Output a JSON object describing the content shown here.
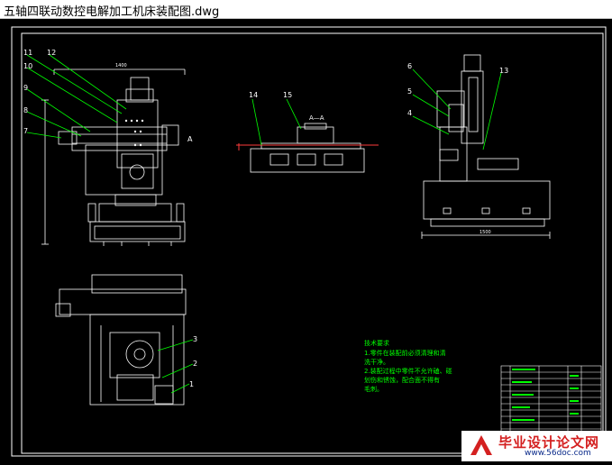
{
  "window": {
    "title": "五轴四联动数控电解加工机床装配图.dwg"
  },
  "drawing": {
    "background": "#000000",
    "line_color": "#ffffff",
    "leader_color": "#00ff00",
    "callouts": [
      "11",
      "12",
      "10",
      "9",
      "8",
      "7",
      "6",
      "5",
      "4",
      "13",
      "14",
      "15",
      "3",
      "2",
      "1"
    ],
    "section_label": "A—A",
    "view_arrow_label": "A",
    "dim_top": "1400",
    "dim_right": "1500"
  },
  "notes": {
    "title": "技术要求",
    "lines": [
      "1.零件在装配前必须清理和清",
      "洗干净。",
      "2.装配过程中零件不允许磕、碰",
      "划伤和锈蚀，配合面不得有",
      "毛刺。"
    ]
  },
  "watermark": {
    "text": "毕业设计论文网",
    "url": "www.56doc.com"
  }
}
